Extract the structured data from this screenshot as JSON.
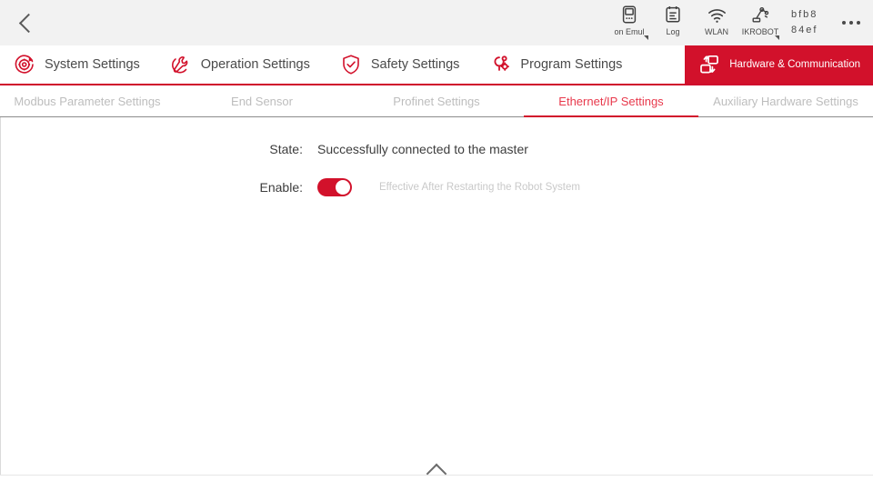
{
  "statusbar": {
    "back_icon": "chevron-left-icon",
    "items": [
      {
        "icon": "teach-pendant-icon",
        "label": "on Emul",
        "caret": true
      },
      {
        "icon": "log-clipboard-icon",
        "label": "Log",
        "caret": false
      },
      {
        "icon": "wifi-icon",
        "label": "WLAN",
        "caret": false
      },
      {
        "icon": "robot-arm-icon",
        "label": "IKROBOT",
        "caret": true
      }
    ],
    "device_id_line1": "bfb8",
    "device_id_line2": "84ef",
    "overflow_icon": "more-horizontal-icon"
  },
  "mainnav": {
    "items": [
      {
        "label": "System Settings",
        "icon": "gear-refresh-icon",
        "active": false
      },
      {
        "label": "Operation Settings",
        "icon": "wrench-circle-icon",
        "active": false
      },
      {
        "label": "Safety Settings",
        "icon": "shield-check-icon",
        "active": false
      },
      {
        "label": "Program Settings",
        "icon": "program-node-icon",
        "active": false
      },
      {
        "label": "Hardware & Communication",
        "icon": "hardware-exchange-icon",
        "active": true
      }
    ],
    "accent_color": "#d2112b"
  },
  "subtabs": {
    "items": [
      {
        "label": "Modbus Parameter Settings",
        "active": false
      },
      {
        "label": "End Sensor",
        "active": false
      },
      {
        "label": "Profinet Settings",
        "active": false
      },
      {
        "label": "Ethernet/IP Settings",
        "active": true
      },
      {
        "label": "Auxiliary Hardware Settings",
        "active": false
      }
    ],
    "active_color": "#e8394c",
    "inactive_color": "#bdbdbd"
  },
  "content": {
    "state_label": "State:",
    "state_value": "Successfully connected to the master",
    "enable_label": "Enable:",
    "enable_on": true,
    "enable_hint": "Effective After Restarting the Robot System",
    "toggle_on_color": "#d2112b"
  },
  "bottombar": {
    "handle_icon": "chevron-up-icon"
  }
}
